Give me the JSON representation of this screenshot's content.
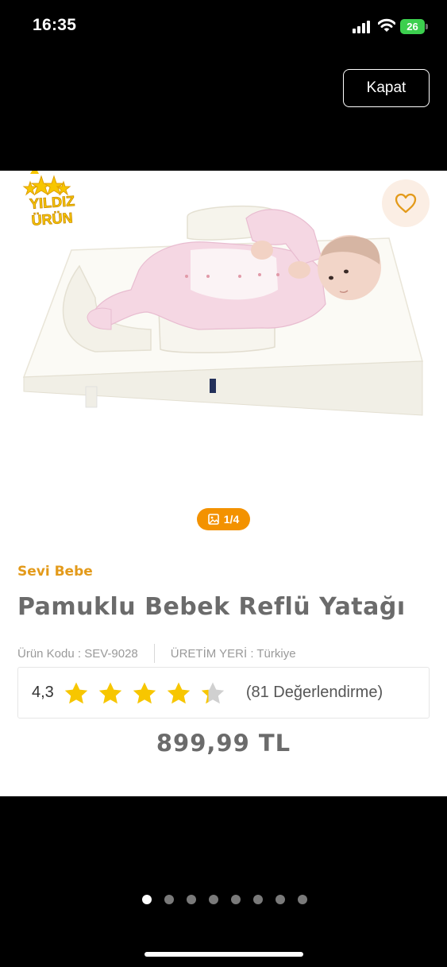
{
  "status_bar": {
    "time": "16:35",
    "battery": "26"
  },
  "header": {
    "close_label": "Kapat"
  },
  "product": {
    "badge_line1": "YILDIZ",
    "badge_line2": "ÜRÜN",
    "image_counter": "1/4",
    "brand": "Sevi Bebe",
    "title": "Pamuklu Bebek Reflü Yatağı",
    "code_text": "Ürün Kodu : SEV-9028",
    "origin_text": "ÜRETİM YERİ : Türkiye",
    "rating_value": "4,3",
    "rating": 4.3,
    "rating_max": 5,
    "rating_count": "(81 Değerlendirme)",
    "price": "899,99 TL"
  },
  "carousel": {
    "total_pages": 8,
    "active_page": 1
  },
  "colors": {
    "accent": "#f39200",
    "brand": "#e39a1a",
    "star": "#f7c600",
    "star_empty": "#d0d0d0"
  },
  "icons": [
    "signal-icon",
    "wifi-icon",
    "battery-icon",
    "heart-icon",
    "image-icon",
    "star-icon"
  ]
}
